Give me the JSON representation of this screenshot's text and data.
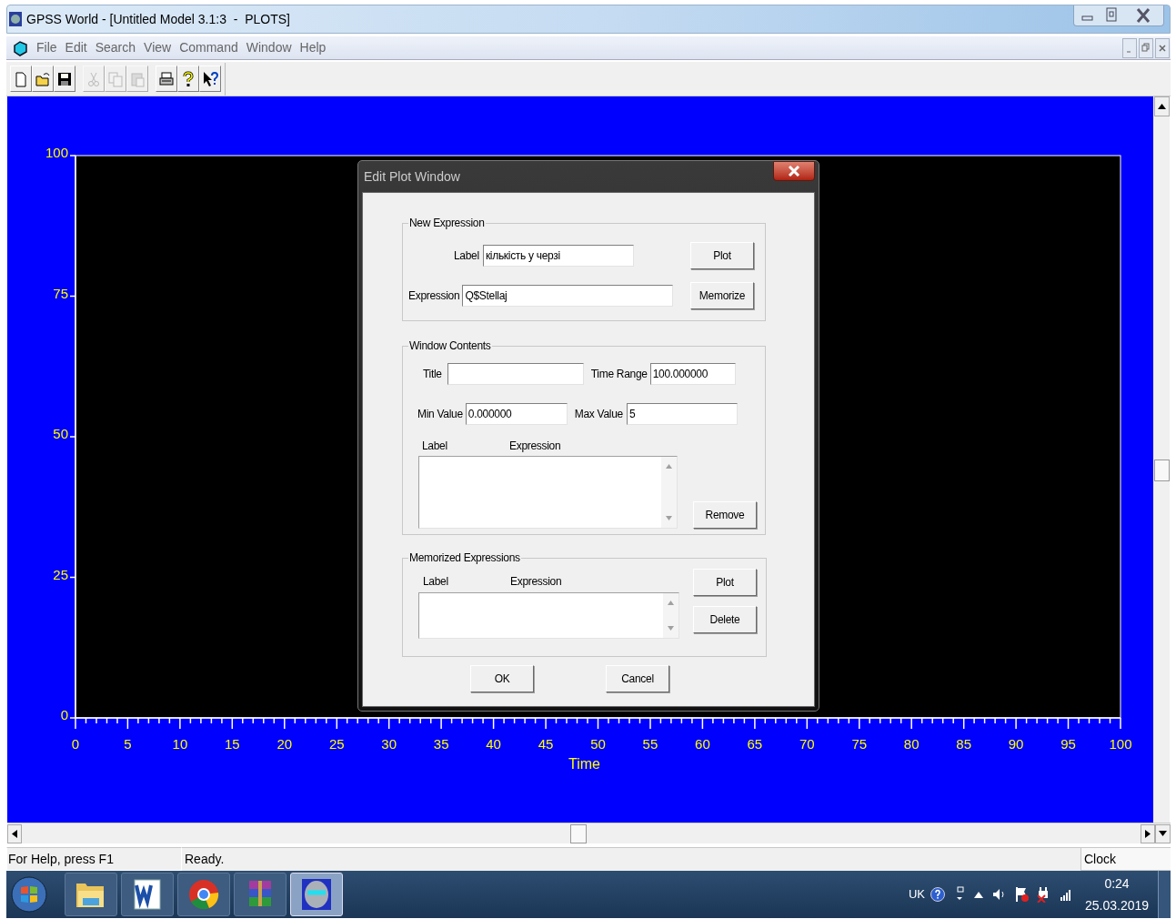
{
  "window": {
    "title": "GPSS World - [Untitled Model 3.1:3  -  PLOTS]"
  },
  "menu": [
    "File",
    "Edit",
    "Search",
    "View",
    "Command",
    "Window",
    "Help"
  ],
  "toolbar": [
    {
      "kind": "new",
      "disabled": false
    },
    {
      "kind": "open",
      "disabled": false
    },
    {
      "kind": "save",
      "disabled": false
    },
    {
      "kind": "cut",
      "disabled": true
    },
    {
      "kind": "copy",
      "disabled": true
    },
    {
      "kind": "paste",
      "disabled": true
    },
    {
      "kind": "print",
      "disabled": false
    },
    {
      "kind": "help",
      "disabled": false
    },
    {
      "kind": "context-help",
      "disabled": false
    }
  ],
  "plot": {
    "chart_data": {
      "type": "line",
      "xlabel": "Time",
      "xlim": [
        0,
        100
      ],
      "ylim": [
        0,
        100
      ],
      "xticks": [
        0,
        5,
        10,
        15,
        20,
        25,
        30,
        35,
        40,
        45,
        50,
        55,
        60,
        65,
        70,
        75,
        80,
        85,
        90,
        95,
        100
      ],
      "yticks": [
        0,
        25,
        50,
        75,
        100
      ]
    }
  },
  "dialog": {
    "title": "Edit Plot Window",
    "new_expression": {
      "legend": "New Expression",
      "label_caption": "Label",
      "label_value": "кількість у черзі",
      "expression_caption": "Expression",
      "expression_value": "Q$Stellaj",
      "plot_button": "Plot",
      "memorize_button": "Memorize"
    },
    "window_contents": {
      "legend": "Window Contents",
      "title_caption": "Title",
      "time_range_caption": "Time Range",
      "time_range_value": "100.000000",
      "min_caption": "Min Value",
      "min_value": "0.000000",
      "max_caption": "Max Value",
      "max_value": "5",
      "columns": [
        "Label",
        "Expression"
      ],
      "remove_button": "Remove"
    },
    "memorized": {
      "legend": "Memorized Expressions",
      "columns": [
        "Label",
        "Expression"
      ],
      "plot_button": "Plot",
      "delete_button": "Delete"
    },
    "ok_button": "OK",
    "cancel_button": "Cancel"
  },
  "status_bar": {
    "help": "For Help, press F1",
    "state": "Ready.",
    "clock": "Clock"
  },
  "taskbar": {
    "apps": [
      {
        "kind": "folder",
        "selected": false
      },
      {
        "kind": "word",
        "selected": false
      },
      {
        "kind": "chrome",
        "selected": false
      },
      {
        "kind": "archive",
        "selected": false
      },
      {
        "kind": "gpss",
        "selected": true
      }
    ],
    "tray": {
      "language": "UK",
      "time": "0:24",
      "date": "25.03.2019"
    }
  }
}
